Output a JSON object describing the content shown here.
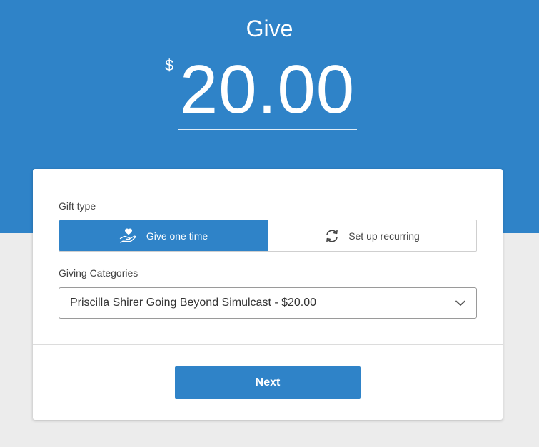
{
  "header": {
    "title": "Give",
    "currency_symbol": "$",
    "amount": "20.00"
  },
  "gift_type": {
    "label": "Gift type",
    "options": [
      {
        "label": "Give one time",
        "icon": "hand-heart-icon",
        "selected": true
      },
      {
        "label": "Set up recurring",
        "icon": "recurring-icon",
        "selected": false
      }
    ]
  },
  "giving_categories": {
    "label": "Giving Categories",
    "selected": "Priscilla Shirer Going Beyond Simulcast - $20.00"
  },
  "actions": {
    "next_label": "Next"
  },
  "colors": {
    "brand": "#2f83c8",
    "page_background": "#ececec"
  }
}
